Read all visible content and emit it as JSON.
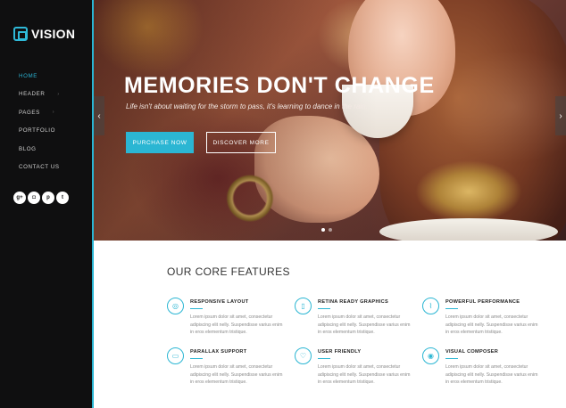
{
  "brand": {
    "name": "VISION",
    "accent": "#2bb6d3"
  },
  "nav": [
    {
      "label": "HOME",
      "active": true,
      "submenu": false
    },
    {
      "label": "HEADER",
      "active": false,
      "submenu": true
    },
    {
      "label": "PAGES",
      "active": false,
      "submenu": true
    },
    {
      "label": "PORTFOLIO",
      "active": false,
      "submenu": false
    },
    {
      "label": "BLOG",
      "active": false,
      "submenu": false
    },
    {
      "label": "CONTACT US",
      "active": false,
      "submenu": false
    }
  ],
  "socials": [
    {
      "name": "google-plus",
      "glyph": "g+"
    },
    {
      "name": "instagram",
      "glyph": "◘"
    },
    {
      "name": "pinterest",
      "glyph": "p"
    },
    {
      "name": "twitter",
      "glyph": "t"
    }
  ],
  "hero": {
    "title": "MEMORIES DON'T CHANGE",
    "subtitle": "Life isn't about waiting for the storm to pass, it's learning to dance in the rain.",
    "primary_button": "PURCHASE NOW",
    "secondary_button": "DISCOVER MORE",
    "prev_glyph": "‹",
    "next_glyph": "›",
    "slides": 2,
    "active_slide": 0
  },
  "features": {
    "title": "OUR CORE FEATURES",
    "items": [
      {
        "icon": "camera-icon",
        "glyph": "◎",
        "title": "RESPONSIVE LAYOUT",
        "text": "Lorem ipsum dolor sit amet, consectetur adipiscing elit nelly. Suspendisse varius enim in eros elementum tristique."
      },
      {
        "icon": "mobile-icon",
        "glyph": "▯",
        "title": "RETINA READY GRAPHICS",
        "text": "Lorem ipsum dolor sit amet, consectetur adipiscing elit nelly. Suspendisse varius enim in eros elementum tristique."
      },
      {
        "icon": "chart-icon",
        "glyph": "⌇",
        "title": "POWERFUL PERFORMANCE",
        "text": "Lorem ipsum dolor sit amet, consectetur adipiscing elit nelly. Suspendisse varius enim in eros elementum tristique."
      },
      {
        "icon": "chat-icon",
        "glyph": "▭",
        "title": "PARALLAX SUPPORT",
        "text": "Lorem ipsum dolor sit amet, consectetur adipiscing elit nelly. Suspendisse varius enim in eros elementum tristique."
      },
      {
        "icon": "heart-icon",
        "glyph": "♡",
        "title": "USER FRIENDLY",
        "text": "Lorem ipsum dolor sit amet, consectetur adipiscing elit nelly. Suspendisse varius enim in eros elementum tristique."
      },
      {
        "icon": "globe-icon",
        "glyph": "◉",
        "title": "VISUAL COMPOSER",
        "text": "Lorem ipsum dolor sit amet, consectetur adipiscing elit nelly. Suspendisse varius enim in eros elementum tristique."
      }
    ]
  }
}
